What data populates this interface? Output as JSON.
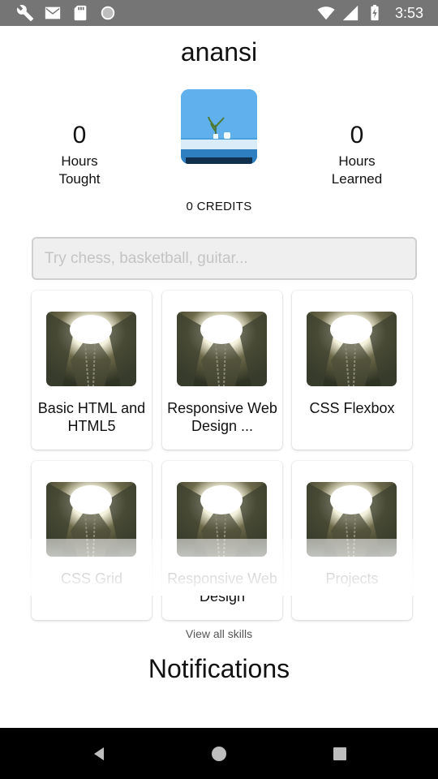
{
  "status_bar": {
    "time": "3:53",
    "icons": [
      "wrench-icon",
      "gmail-icon",
      "sd-card-icon",
      "circle-icon",
      "wifi-icon",
      "signal-icon",
      "battery-charging-icon"
    ]
  },
  "profile": {
    "username": "anansi",
    "hours_taught_value": "0",
    "hours_taught_label": "Hours\nTought",
    "hours_learned_value": "0",
    "hours_learned_label": "Hours\nLearned",
    "credits": "0 CREDITS"
  },
  "search": {
    "placeholder": "Try chess, basketball, guitar..."
  },
  "skills": [
    {
      "title": "Basic HTML and HTML5"
    },
    {
      "title": "Responsive Web Design ..."
    },
    {
      "title": "CSS Flexbox"
    },
    {
      "title": "CSS Grid"
    },
    {
      "title": "Responsive Web Design"
    },
    {
      "title": "Projects"
    }
  ],
  "view_all_label": "View all skills",
  "notifications_title": "Notifications",
  "nav_bar": {
    "icons": [
      "back-icon",
      "home-icon",
      "recents-icon"
    ]
  },
  "colors": {
    "status_bar": "#757575",
    "nav_bar": "#000000",
    "search_bg": "#efefef"
  }
}
